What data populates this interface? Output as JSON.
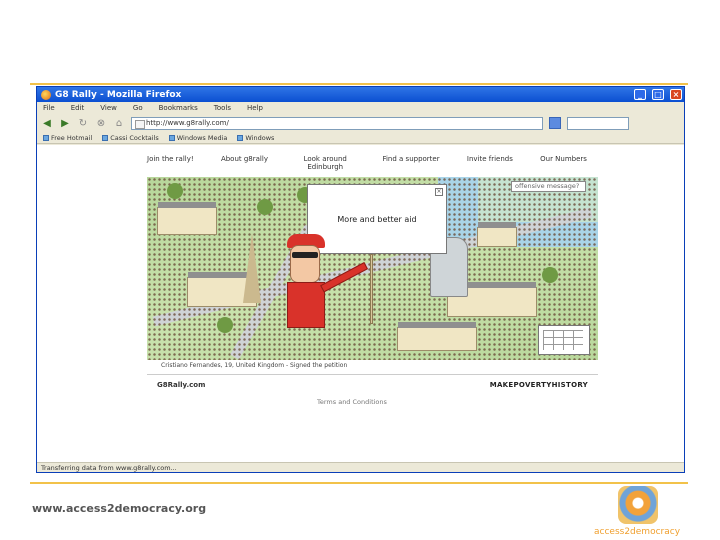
{
  "browser": {
    "title": "G8 Rally - Mozilla Firefox",
    "menu": [
      "File",
      "Edit",
      "View",
      "Go",
      "Bookmarks",
      "Tools",
      "Help"
    ],
    "address": "http://www.g8rally.com/",
    "bookmarks": [
      "Free Hotmail",
      "Cassi Cocktails",
      "Windows Media",
      "Windows"
    ],
    "status": "Transferring data from www.g8rally.com..."
  },
  "site": {
    "nav": [
      "Join the rally!",
      "About g8rally",
      "Look around Edinburgh",
      "Find a supporter",
      "Invite friends",
      "Our Numbers"
    ],
    "search_placeholder": "offensive message?",
    "placard_text": "More and better aid",
    "signed_text": "Cristiano Fernandes, 19, United Kingdom - Signed the petition",
    "left_logo": "G8Rally.com",
    "right_logo": "MAKEPOVERTYHISTORY",
    "terms": "Terms and Conditions"
  },
  "slide": {
    "url": "www.access2democracy.org",
    "logo_text": "access2democracy"
  },
  "colors": {
    "accent_line": "#f2c24a",
    "titlebar": "#0b4fd1"
  }
}
